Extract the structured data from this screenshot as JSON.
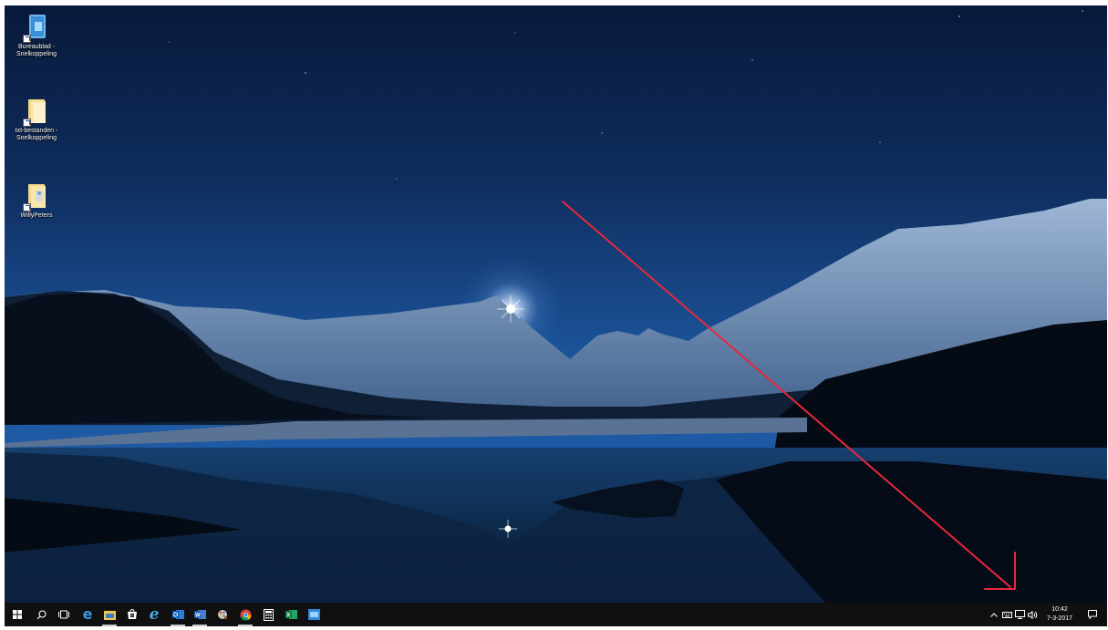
{
  "desktop": {
    "icons": [
      {
        "label_line1": "Bureaublad -",
        "label_line2": "Snelkoppeling",
        "icon": "desktop-shortcut-icon"
      },
      {
        "label_line1": "txt-bestanden -",
        "label_line2": "Snelkoppeling",
        "icon": "folder-shortcut-icon"
      },
      {
        "label_line1": "WillyPeters",
        "label_line2": "",
        "icon": "user-folder-shortcut-icon"
      }
    ]
  },
  "taskbar": {
    "buttons": [
      {
        "name": "start-button",
        "icon": "windows-logo-icon"
      },
      {
        "name": "search-button",
        "icon": "search-icon"
      },
      {
        "name": "task-view-button",
        "icon": "task-view-icon"
      },
      {
        "name": "edge-button",
        "icon": "edge-icon"
      },
      {
        "name": "file-explorer-button",
        "icon": "folder-icon"
      },
      {
        "name": "store-button",
        "icon": "store-icon"
      },
      {
        "name": "internet-explorer-button",
        "icon": "internet-explorer-icon"
      },
      {
        "name": "outlook-button",
        "icon": "outlook-icon"
      },
      {
        "name": "word-button",
        "icon": "word-icon"
      },
      {
        "name": "paint-button",
        "icon": "paint-icon"
      },
      {
        "name": "chrome-button",
        "icon": "chrome-icon"
      },
      {
        "name": "calculator-button",
        "icon": "calculator-icon"
      },
      {
        "name": "excel-button",
        "icon": "excel-icon"
      },
      {
        "name": "remote-desktop-button",
        "icon": "remote-desktop-icon"
      }
    ],
    "tray": {
      "time": "10:42",
      "date": "7-3-2017",
      "icons": [
        "chevron-up-icon",
        "keyboard-icon",
        "network-icon",
        "volume-icon",
        "action-center-icon"
      ]
    }
  },
  "colors": {
    "sky_top": "#08193a",
    "sky_mid": "#1a4f93",
    "taskbar": "#101010",
    "annotation_arrow": "#e8283a"
  }
}
